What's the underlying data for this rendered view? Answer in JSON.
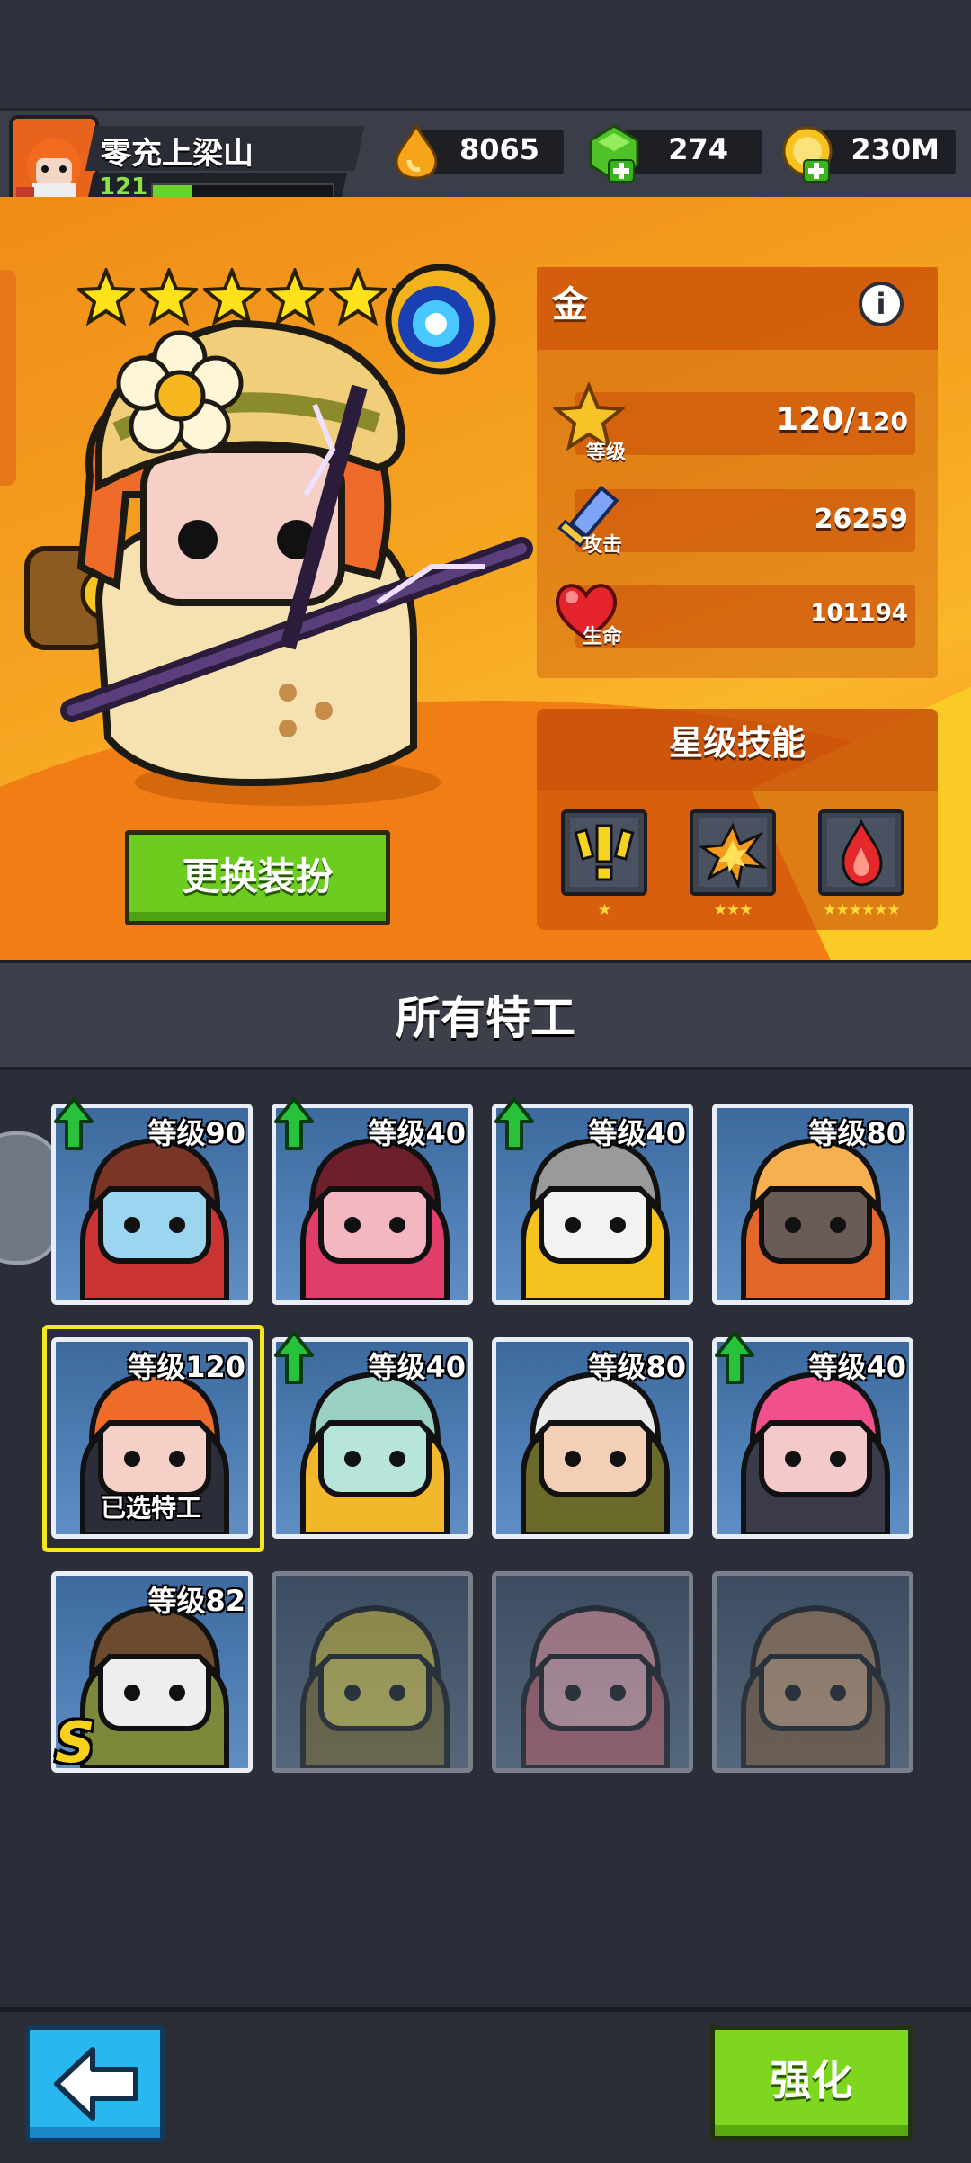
{
  "player": {
    "name": "零充上梁山",
    "level": "121",
    "xp_fraction": 0.22
  },
  "resources": [
    {
      "icon": "flame-drop-icon",
      "value": "8065"
    },
    {
      "icon": "green-gem-plus-icon",
      "value": "274"
    },
    {
      "icon": "gold-coin-plus-icon",
      "value": "230M"
    }
  ],
  "hero": {
    "stars": 6,
    "rarity": "金",
    "stats": [
      {
        "icon": "level-star-icon",
        "label": "等级",
        "value": "120/",
        "max": "120"
      },
      {
        "icon": "sword-icon",
        "label": "攻击",
        "value": "26259"
      },
      {
        "icon": "heart-icon",
        "label": "生命",
        "value": "101194"
      }
    ],
    "skills_title": "星级技能",
    "skills": [
      {
        "icon": "exclamation-skill-icon",
        "stars": "★"
      },
      {
        "icon": "explosion-skill-icon",
        "stars": "★★★"
      },
      {
        "icon": "fire-skill-icon",
        "stars": "★★★★★★"
      }
    ],
    "change_skin_label": "更换装扮"
  },
  "agents": {
    "title": "所有特工",
    "selected_label": "已选特工",
    "cards": [
      {
        "level": "等级90",
        "upgrade": true,
        "locked": false,
        "name": "goggles-agent"
      },
      {
        "level": "等级40",
        "upgrade": true,
        "locked": false,
        "name": "maroon-hair-agent"
      },
      {
        "level": "等级40",
        "upgrade": true,
        "locked": false,
        "name": "cat-agent"
      },
      {
        "level": "等级80",
        "upgrade": false,
        "locked": false,
        "name": "masked-agent"
      },
      {
        "level": "等级120",
        "upgrade": false,
        "locked": false,
        "name": "redhead-agent"
      },
      {
        "level": "等级40",
        "upgrade": true,
        "locked": false,
        "name": "squidward-agent"
      },
      {
        "level": "等级80",
        "upgrade": false,
        "locked": false,
        "name": "sunglasses-agent"
      },
      {
        "level": "等级40",
        "upgrade": true,
        "locked": false,
        "name": "pink-hair-agent"
      },
      {
        "level": "等级82",
        "upgrade": false,
        "locked": false,
        "name": "panda-agent",
        "badge": "S"
      },
      {
        "level": "",
        "upgrade": false,
        "locked": true,
        "name": "spongebob-agent"
      },
      {
        "level": "",
        "upgrade": false,
        "locked": true,
        "name": "patrick-agent"
      },
      {
        "level": "",
        "upgrade": false,
        "locked": true,
        "name": "sandy-agent"
      }
    ]
  },
  "bottom": {
    "enhance_label": "强化"
  },
  "colors": {
    "accent_green": "#7fd61e",
    "accent_orange": "#f5a320",
    "back_blue": "#28b8ef",
    "select_yellow": "#f6e71f"
  }
}
